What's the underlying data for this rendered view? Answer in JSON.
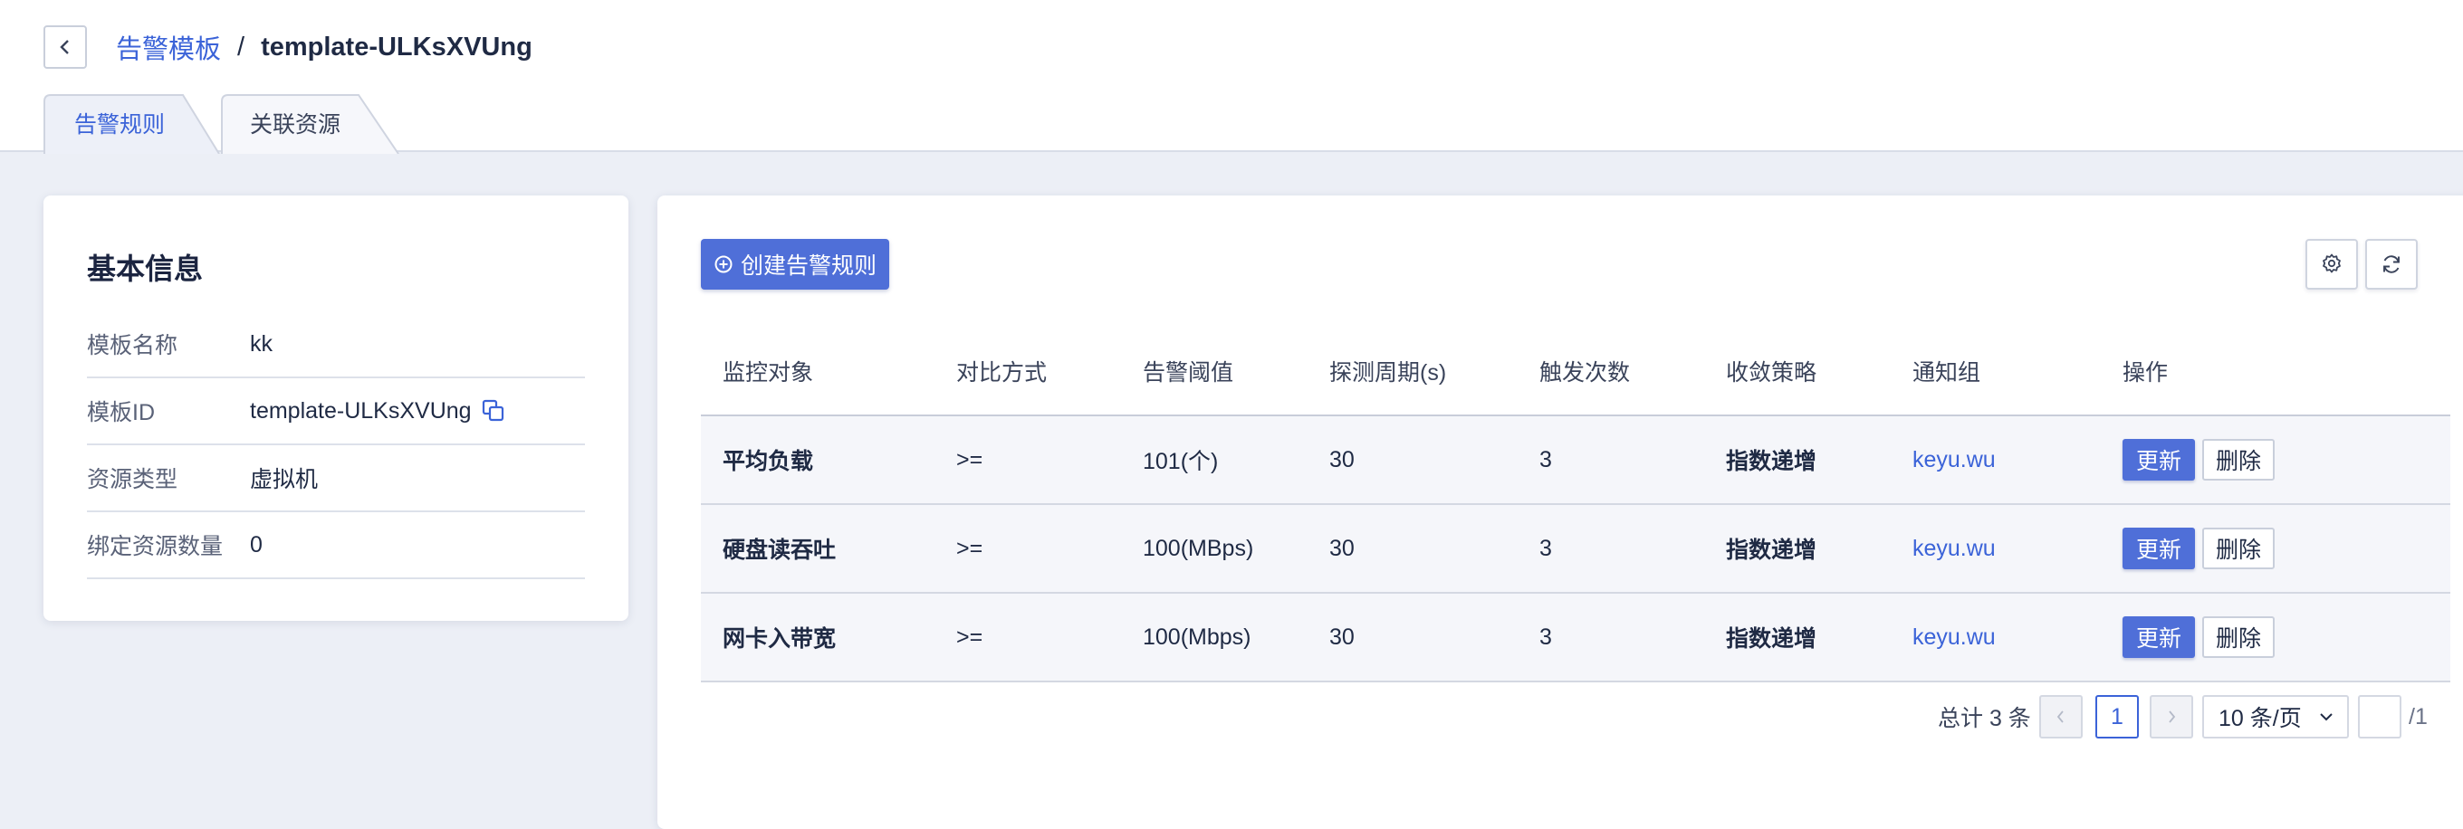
{
  "breadcrumb": {
    "parent": "告警模板",
    "separator": "/",
    "current": "template-ULKsXVUng"
  },
  "tabs": [
    {
      "label": "告警规则",
      "active": true
    },
    {
      "label": "关联资源",
      "active": false
    }
  ],
  "info": {
    "title": "基本信息",
    "rows": [
      {
        "label": "模板名称",
        "value": "kk"
      },
      {
        "label": "模板ID",
        "value": "template-ULKsXVUng"
      },
      {
        "label": "资源类型",
        "value": "虚拟机"
      },
      {
        "label": "绑定资源数量",
        "value": "0"
      }
    ]
  },
  "toolbar": {
    "create_label": "创建告警规则",
    "settings_icon": "gear-icon",
    "refresh_icon": "refresh-icon"
  },
  "table": {
    "headers": [
      "监控对象",
      "对比方式",
      "告警阈值",
      "探测周期(s)",
      "触发次数",
      "收敛策略",
      "通知组",
      "操作"
    ],
    "rows": [
      {
        "target": "平均负载",
        "compare": ">=",
        "threshold": "101(个)",
        "period": "30",
        "count": "3",
        "strategy": "指数递增",
        "group": "keyu.wu"
      },
      {
        "target": "硬盘读吞吐",
        "compare": ">=",
        "threshold": "100(MBps)",
        "period": "30",
        "count": "3",
        "strategy": "指数递增",
        "group": "keyu.wu"
      },
      {
        "target": "网卡入带宽",
        "compare": ">=",
        "threshold": "100(Mbps)",
        "period": "30",
        "count": "3",
        "strategy": "指数递增",
        "group": "keyu.wu"
      }
    ],
    "update_label": "更新",
    "delete_label": "删除"
  },
  "pagination": {
    "total": "总计 3 条",
    "current_page": "1",
    "page_size": "10 条/页",
    "jump_value": "",
    "page_count": "/1"
  },
  "colors": {
    "accent": "#4f6fd8",
    "link": "#3b63d8",
    "background": "#eceff6"
  }
}
